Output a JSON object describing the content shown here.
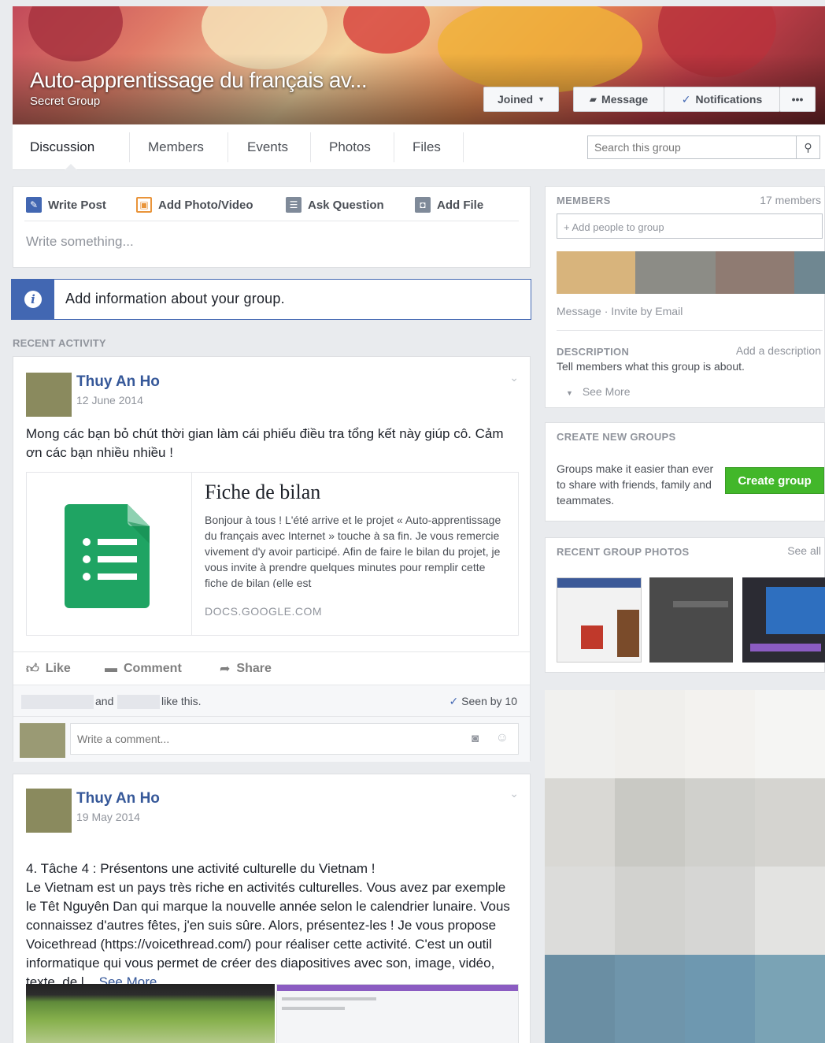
{
  "group": {
    "title": "Auto-apprentissage du français av...",
    "privacy": "Secret Group",
    "buttons": {
      "joined": "Joined",
      "message": "Message",
      "notifications": "Notifications",
      "more": "•••"
    }
  },
  "tabs": [
    "Discussion",
    "Members",
    "Events",
    "Photos",
    "Files"
  ],
  "search": {
    "placeholder": "Search this group"
  },
  "composer": {
    "write_post": "Write Post",
    "add_photo": "Add Photo/Video",
    "ask_question": "Ask Question",
    "add_file": "Add File",
    "placeholder": "Write something..."
  },
  "info_banner": "Add information about your group.",
  "recent_activity_label": "RECENT ACTIVITY",
  "posts": [
    {
      "author": "Thuy An Ho",
      "date": "12 June 2014",
      "text": "Mong các bạn bỏ chút thời gian làm cái phiếu điều tra tổng kết này giúp cô. Cảm ơn các bạn nhiều nhiều !",
      "link": {
        "title": "Fiche de bilan",
        "description": "Bonjour à tous ! L'été arrive et le projet « Auto-apprentissage du français avec Internet » touche à sa fin. Je vous remercie vivement d'y avoir participé. Afin de faire le bilan du projet, je vous invite à prendre quelques minutes pour remplir cette fiche de bilan (elle est",
        "source": "DOCS.GOOGLE.COM"
      },
      "actions": {
        "like": "Like",
        "comment": "Comment",
        "share": "Share"
      },
      "likes": {
        "and": "and",
        "like_this": "like this.",
        "seen": "Seen by 10"
      },
      "comment_placeholder": "Write a comment..."
    },
    {
      "author": "Thuy An Ho",
      "date": "19 May 2014",
      "text": "4. Tâche 4 : Présentons une activité culturelle du Vietnam !\nLe Vietnam est un pays très riche en activités culturelles. Vous avez par exemple le Têt Nguyên Dan qui marque la nouvelle année selon le calendrier lunaire. Vous connaissez d'autres fêtes, j'en suis sûre. Alors, présentez-les ! Je vous propose Voicethread (https://voicethread.com/) pour réaliser cette activité. C'est un outil informatique qui vous permet de créer des diapositives avec son, image, vidéo, texte, de l...",
      "see_more": "See More"
    }
  ],
  "sidebar": {
    "members": {
      "heading": "MEMBERS",
      "count": "17 members",
      "add_placeholder": "+ Add people to group",
      "message": "Message",
      "dot": "·",
      "invite": "Invite by Email"
    },
    "description": {
      "heading": "DESCRIPTION",
      "add": "Add a description",
      "text": "Tell members what this group is about.",
      "see_more": "See More"
    },
    "create": {
      "heading": "CREATE NEW GROUPS",
      "text": "Groups make it easier than ever to share with friends, family and teammates.",
      "button": "Create group"
    },
    "photos": {
      "heading": "RECENT GROUP PHOTOS",
      "see_all": "See all"
    }
  },
  "colors": {
    "brand_blue": "#4267b2",
    "link_blue": "#365899",
    "create_green": "#42b72a",
    "member_swatches": [
      "#d8b47c",
      "#8c8c86",
      "#8f7b72",
      "#6f8791"
    ],
    "mosaic": [
      "#f1f1ef",
      "#f0efec",
      "#f3f2ef",
      "#f5f5f3",
      "#d9d8d4",
      "#c9c9c4",
      "#d0d0cc",
      "#d5d4d0",
      "#dcdcda",
      "#d2d2cf",
      "#d6d6d4",
      "#e3e3e1",
      "#6a8ea3",
      "#6f95ab",
      "#6e98b0",
      "#7aa3b5"
    ]
  }
}
